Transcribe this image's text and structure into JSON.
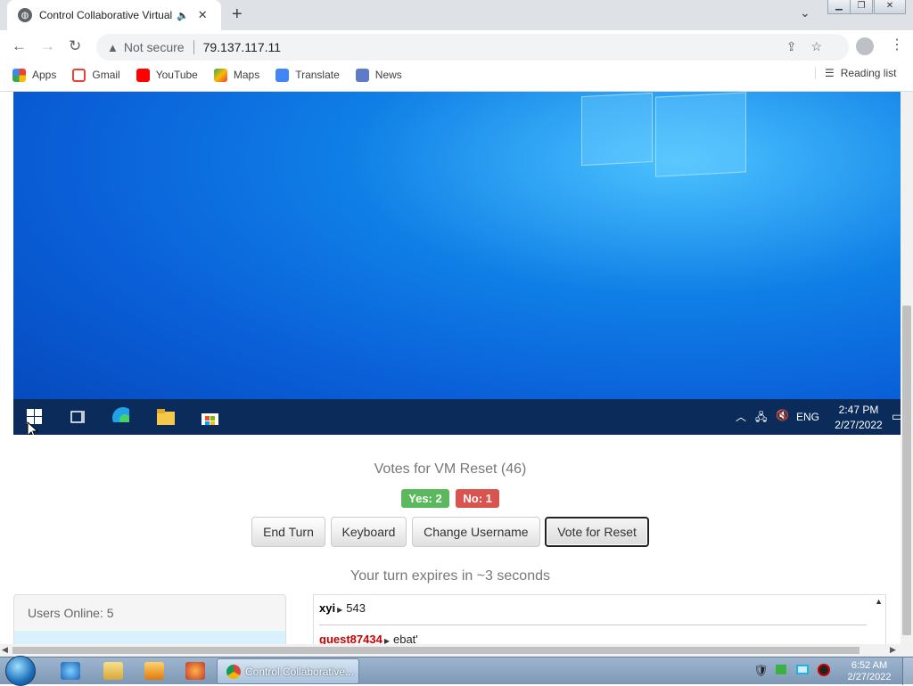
{
  "browser": {
    "tab_title": "Control Collaborative Virtual",
    "url_warning": "Not secure",
    "url": "79.137.117.11",
    "bookmarks": [
      "Apps",
      "Gmail",
      "YouTube",
      "Maps",
      "Translate",
      "News"
    ],
    "reading_list": "Reading list"
  },
  "vm": {
    "tray_lang": "ENG",
    "tray_time": "2:47 PM",
    "tray_date": "2/27/2022"
  },
  "controls": {
    "votes_title": "Votes for VM Reset (46)",
    "yes_label": "Yes: 2",
    "no_label": "No: 1",
    "buttons": {
      "end_turn": "End Turn",
      "keyboard": "Keyboard",
      "change_username": "Change Username",
      "vote_reset": "Vote for Reset"
    },
    "turn_text": "Your turn expires in ~3 seconds"
  },
  "users": {
    "header": "Users Online: 5"
  },
  "chat": {
    "messages": [
      {
        "user": "xyi",
        "text": "543",
        "color": "#000000"
      },
      {
        "user": "guest87434",
        "text": "ebat'",
        "color": "#cc0000"
      }
    ]
  },
  "taskbar": {
    "task_label": "Control Collaborative...",
    "time": "6:52 AM",
    "date": "2/27/2022"
  },
  "colors": {
    "yes": "#5cb85c",
    "no": "#d9534f",
    "vm_taskbar": "#0b2c5a"
  }
}
